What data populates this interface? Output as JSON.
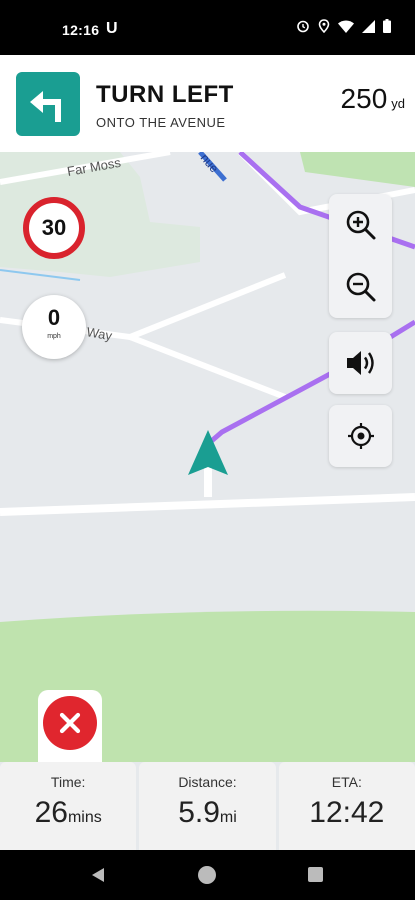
{
  "status_bar": {
    "time": "12:16",
    "notification_icon": "U",
    "icons": [
      "alarm-icon",
      "location-icon",
      "wifi-icon",
      "signal-icon",
      "battery-icon"
    ]
  },
  "navigation": {
    "maneuver_icon": "turn-left-arrow-icon",
    "instruction": "TURN LEFT",
    "subtitle": "ONTO THE AVENUE",
    "distance": "250",
    "distance_unit": "yd",
    "accent_color": "#1a9e92"
  },
  "map": {
    "street_labels": [
      "Far Moss",
      "Way",
      "nue"
    ],
    "route_color": "#a970f0"
  },
  "speed": {
    "limit": "30",
    "current": "0",
    "current_unit": "mph"
  },
  "map_controls": {
    "zoom_in": "zoom-in-icon",
    "zoom_out": "zoom-out-icon",
    "sound": "volume-icon",
    "recenter": "my-location-icon"
  },
  "cancel": {
    "icon": "close-icon",
    "color": "#e0262e"
  },
  "trip": {
    "time_label": "Time:",
    "time_value": "26",
    "time_unit": "mins",
    "distance_label": "Distance:",
    "distance_value": "5.9",
    "distance_unit": "mi",
    "eta_label": "ETA:",
    "eta_value": "12:42"
  }
}
